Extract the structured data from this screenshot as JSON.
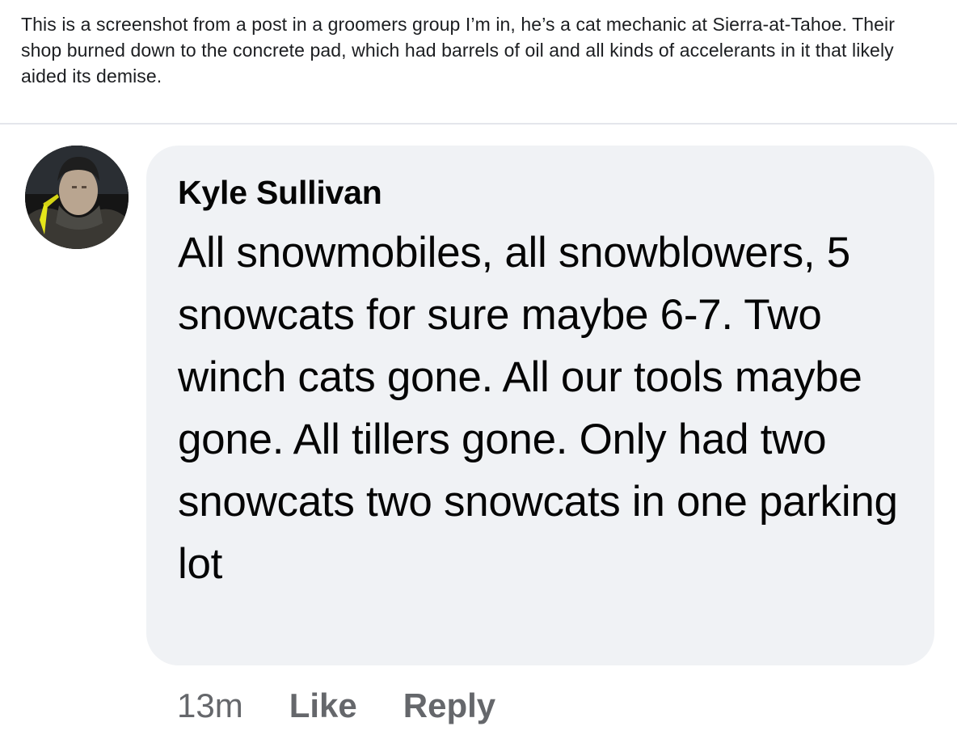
{
  "post": {
    "caption": "This is a screenshot from a post in a groomers group I’m in, he’s a cat mechanic at Sierra-at-Tahoe. Their shop burned down to the concrete pad, which had barrels of oil and all kinds of accelerants in it that likely aided its demise."
  },
  "comment": {
    "author": "Kyle Sullivan",
    "text": "All snowmobiles, all snowblowers, 5 snowcats for sure maybe 6-7. Two winch cats gone. All our tools maybe gone. All tillers gone. Only had two snowcats two snowcats in one parking lot",
    "time": "13m",
    "like_label": "Like",
    "reply_label": "Reply"
  },
  "colors": {
    "bubble": "#f0f2f5",
    "meta_text": "#65676b",
    "body_text": "#050505"
  }
}
